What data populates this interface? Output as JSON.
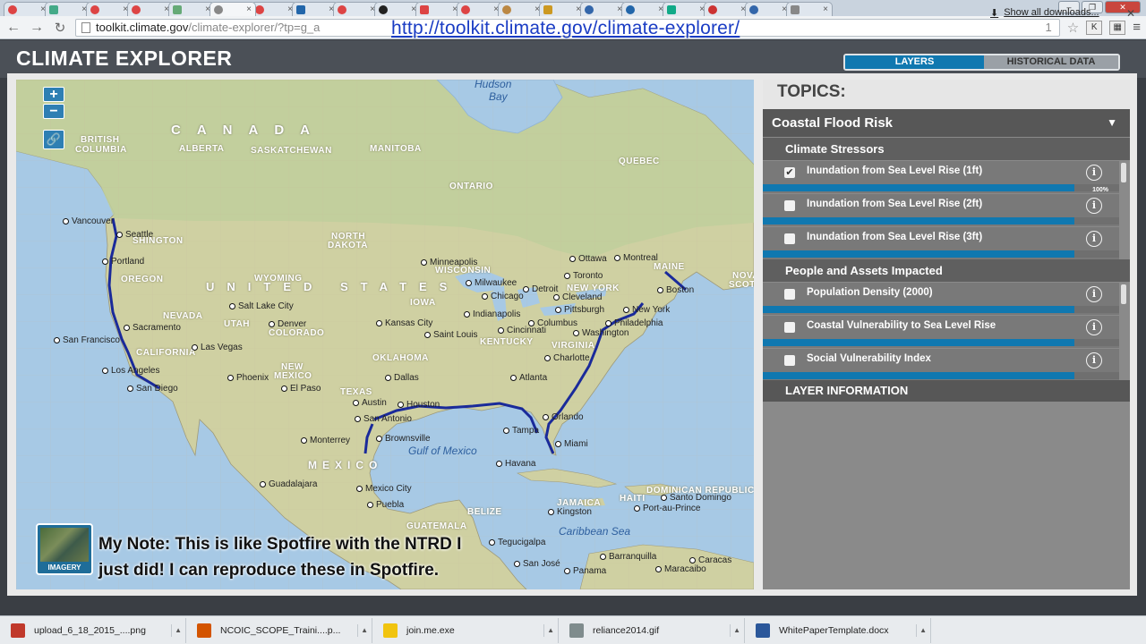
{
  "browser": {
    "tab_count": 20,
    "url_main": "toolkit.climate.gov",
    "url_rest": "/climate-explorer/?tp=g_a",
    "url_tail": "1",
    "overlay_link": "http://toolkit.climate.gov/climate-explorer/"
  },
  "app": {
    "title": "CLIMATE EXPLORER",
    "toggle_layers": "LAYERS",
    "toggle_historical": "HISTORICAL DATA"
  },
  "map": {
    "zoom_in": "+",
    "zoom_out": "−",
    "imagery_label": "IMAGERY",
    "labels": {
      "hudson_bay_1": "Hudson",
      "hudson_bay_2": "Bay",
      "canada": "CANADA",
      "united_states": "UNITED STATES",
      "mexico": "MEXICO",
      "gulf": "Gulf of Mexico",
      "caribbean": "Caribbean Sea",
      "bc_1": "BRITISH",
      "bc_2": "COLUMBIA",
      "alberta": "ALBERTA",
      "saskatchewan": "SASKATCHEWAN",
      "manitoba": "MANITOBA",
      "ontario": "ONTARIO",
      "quebec": "QUEBEC",
      "north_dakota_1": "NORTH",
      "north_dakota_2": "DAKOTA",
      "washington": "SHINGTON",
      "oregon": "OREGON",
      "wyoming": "WYOMING",
      "nevada": "NEVADA",
      "utah": "UTAH",
      "colorado": "COLORADO",
      "california": "CALIFORNIA",
      "new_mexico_1": "NEW",
      "new_mexico_2": "MEXICO",
      "texas": "TEXAS",
      "wisconsin": "WISCONSIN",
      "iowa": "IOWA",
      "new_york": "NEW YORK",
      "kentucky": "KENTUCKY",
      "virginia": "VIRGINIA",
      "oklahoma": "OKLAHOMA",
      "maine": "MAINE",
      "nova_scotia_1": "NOVA",
      "nova_scotia_2": "SCOTIA",
      "belize": "BELIZE",
      "guatemala": "GUATEMALA",
      "haiti": "HAITI",
      "dom_rep": "DOMINICAN REPUBLIC",
      "jamaica": "JAMAICA"
    },
    "cities": [
      "Vancouver",
      "Seattle",
      "Portland",
      "Salt Lake City",
      "Denver",
      "Sacramento",
      "San Francisco",
      "Las Vegas",
      "Los Angeles",
      "San Diego",
      "Phoenix",
      "El Paso",
      "Minneapolis",
      "Milwaukee",
      "Chicago",
      "Detroit",
      "Toronto",
      "Ottawa",
      "Montreal",
      "Boston",
      "New York",
      "Philadelphia",
      "Washington",
      "Cleveland",
      "Pittsburgh",
      "Columbus",
      "Cincinnati",
      "Indianapolis",
      "Kansas City",
      "Saint Louis",
      "Charlotte",
      "Atlanta",
      "Dallas",
      "Austin",
      "Houston",
      "San Antonio",
      "Orlando",
      "Tampa",
      "Miami",
      "Monterrey",
      "Brownsville",
      "Guadalajara",
      "Mexico City",
      "Puebla",
      "Havana",
      "Kingston",
      "Port-au-Prince",
      "Santo Domingo",
      "Barranquilla",
      "Caracas",
      "Maracaibo",
      "Panama",
      "San José",
      "Tegucigalpa"
    ],
    "note_line1": "My Note: This is like Spotfire with the NTRD I",
    "note_line2": "just did! I can reproduce  these in Spotfire."
  },
  "sidebar": {
    "heading": "TOPICS:",
    "topic": "Coastal Flood Risk",
    "sections": [
      {
        "title": "Climate Stressors",
        "layers": [
          {
            "name": "Inundation from Sea Level Rise (1ft)",
            "checked": true,
            "opacity_percent": 100,
            "pct_label": "100%"
          },
          {
            "name": "Inundation from Sea Level Rise (2ft)",
            "checked": false,
            "opacity_percent": 100
          },
          {
            "name": "Inundation from Sea Level Rise (3ft)",
            "checked": false,
            "opacity_percent": 100
          }
        ]
      },
      {
        "title": "People and Assets Impacted",
        "layers": [
          {
            "name": "Population Density (2000)",
            "checked": false,
            "opacity_percent": 100
          },
          {
            "name": "Coastal Vulnerability to Sea Level Rise",
            "checked": false,
            "opacity_percent": 100
          },
          {
            "name": "Social Vulnerability Index",
            "checked": false,
            "opacity_percent": 100
          }
        ]
      }
    ],
    "layer_info": "LAYER INFORMATION",
    "info_glyph": "i",
    "check_glyph": "✔"
  },
  "downloads": {
    "items": [
      {
        "file": "upload_6_18_2015_....png",
        "icon_color": "#c0392b"
      },
      {
        "file": "NCOIC_SCOPE_Traini....p...",
        "icon_color": "#d35400"
      },
      {
        "file": "join.me.exe",
        "icon_color": "#f1c40f"
      },
      {
        "file": "reliance2014.gif",
        "icon_color": "#7f8c8d"
      },
      {
        "file": "WhitePaperTemplate.docx",
        "icon_color": "#2b579a"
      }
    ],
    "show_all": "Show all downloads..."
  },
  "colors": {
    "accent": "#1078b0",
    "header": "#4b5057",
    "sidebar_bg": "#8a8a8a"
  }
}
